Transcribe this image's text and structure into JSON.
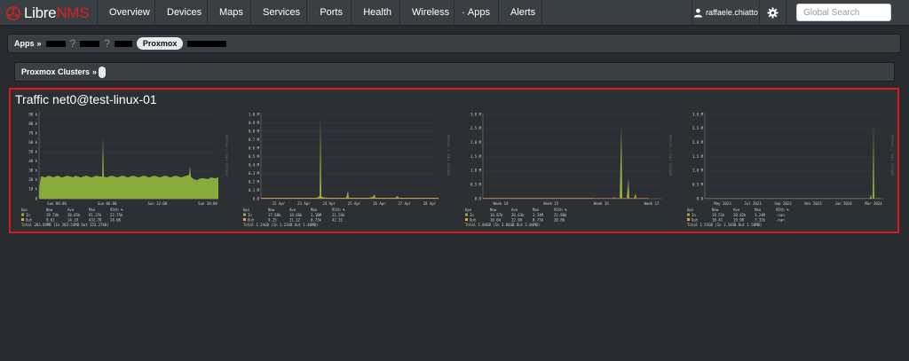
{
  "navbar": {
    "brand_prefix": "Libre",
    "brand_suffix": "NMS",
    "items": [
      {
        "label": "Overview",
        "icon": "home-icon"
      },
      {
        "label": "Devices",
        "icon": "server-icon"
      },
      {
        "label": "Maps",
        "icon": "map-icon"
      },
      {
        "label": "Services",
        "icon": "cogs-icon"
      },
      {
        "label": "Ports",
        "icon": "link-icon"
      },
      {
        "label": "Health",
        "icon": "heartbeat-icon"
      },
      {
        "label": "Wireless",
        "icon": "wifi-icon"
      },
      {
        "label": "Apps",
        "icon": "tasks-icon"
      },
      {
        "label": "Alerts",
        "icon": "alert-circle-icon"
      }
    ],
    "user": "raffaele.chiatto",
    "search_placeholder": "Global Search"
  },
  "breadcrumb": {
    "root": "Apps",
    "separator": "»",
    "question": "?",
    "active": "Proxmox"
  },
  "clusters": {
    "label": "Proxmox Clusters",
    "separator": "»"
  },
  "panel": {
    "title": "Traffic net0@test-linux-01"
  },
  "colors": {
    "in": "#8db33c",
    "out": "#e8a33b",
    "panel_border": "#e0161c",
    "navbar": "#3a3f44",
    "background": "#272b30"
  },
  "graphs": [
    {
      "side_label": "RRDTOOL / TOBI OETIKER",
      "y_ticks": [
        "90 k",
        "80 k",
        "70 k",
        "60 k",
        "50 k",
        "40 k",
        "30 k",
        "20 k",
        "10 k",
        "0"
      ],
      "x_ticks": [
        "Sun 00:00",
        "Sun 06:00",
        "Sun 12:00",
        "Sun 18:00"
      ],
      "legend_header": [
        "bps",
        "Now",
        "Ave",
        "Max",
        "95th %"
      ],
      "in_row": [
        "In",
        "19.74k",
        "18.85k",
        "91.37k",
        "22.75k"
      ],
      "out_row": [
        "Out",
        "9.61",
        "14.19",
        "432.78",
        "24.6K"
      ],
      "total_row": "Total 283.69MB (In 283.54MB Out 153.27kB)"
    },
    {
      "side_label": "RRDTOOL / TOBI OETIKER",
      "y_ticks": [
        "1.0 M",
        "0.9 M",
        "0.8 M",
        "0.7 M",
        "0.6 M",
        "0.5 M",
        "0.4 M",
        "0.3 M",
        "0.2 M",
        "0.1 M",
        "0.0"
      ],
      "x_ticks": [
        "22 Apr",
        "23 Apr",
        "24 Apr",
        "25 Apr",
        "26 Apr",
        "27 Apr",
        "28 Apr"
      ],
      "legend_header": [
        "bps",
        "Now",
        "Ave",
        "Max",
        "95th %"
      ],
      "in_row": [
        "In",
        "17.68k",
        "18.66k",
        "1.10M",
        "21.54k"
      ],
      "out_row": [
        "Out",
        "9.25",
        "21.12",
        "8.73k",
        "42.31"
      ],
      "total_row": "Total 1.24GB (In 1.23GB Out 1.40MB)"
    },
    {
      "side_label": "RRDTOOL / TOBI OETIKER",
      "y_ticks": [
        "3.0 M",
        "2.5 M",
        "2.0 M",
        "1.5 M",
        "1.0 M",
        "0.5 M",
        "0.0"
      ],
      "x_ticks": [
        "Week 14",
        "Week 15",
        "Week 16",
        "Week 17"
      ],
      "legend_header": [
        "bps",
        "Now",
        "Ave",
        "Max",
        "95th %"
      ],
      "in_row": [
        "In",
        "16.87k",
        "20.63k",
        "3.24M",
        "21.80k"
      ],
      "out_row": [
        "Out",
        "10.04",
        "22.98",
        "8.73k",
        "20.86"
      ],
      "total_row": "Total 1.84GB (In 1.84GB Out 2.04MB)"
    },
    {
      "side_label": "RRDTOOL / TOBI OETIKER",
      "y_ticks": [
        "3.0 M",
        "2.5 M",
        "2.0 M",
        "1.5 M",
        "1.0 M",
        "0.5 M",
        "0.0"
      ],
      "x_ticks": [
        "May 2023",
        "Jul 2023",
        "Sep 2023",
        "Nov 2023",
        "Jan 2024",
        "Mar 2024"
      ],
      "legend_header": [
        "bps",
        "Now",
        "Ave",
        "Max",
        "95th %"
      ],
      "in_row": [
        "In",
        "19.51k",
        "20.42k",
        "3.24M",
        "-nan"
      ],
      "out_row": [
        "Out",
        "10.41",
        "19.90",
        "7.32k",
        "-nan"
      ],
      "total_row": "Total 1.55GB (In 1.54GB Out 1.50MB)"
    }
  ]
}
